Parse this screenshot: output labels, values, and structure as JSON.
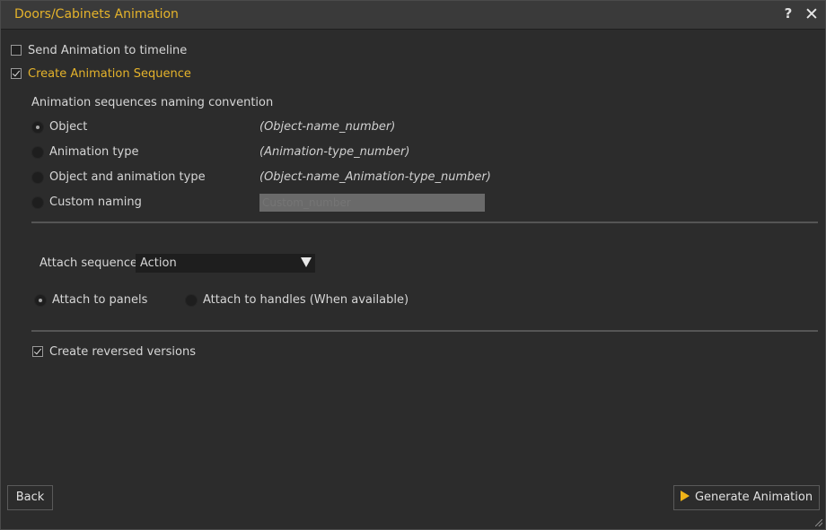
{
  "window": {
    "title": "Doors/Cabinets Animation",
    "help_label": "?",
    "close_label": "✕"
  },
  "options": {
    "send_to_timeline": {
      "label": "Send Animation to timeline",
      "checked": false
    },
    "create_sequence": {
      "label": "Create Animation Sequence",
      "checked": true
    }
  },
  "naming": {
    "heading": "Animation sequences naming convention",
    "choices": [
      {
        "label": "Object",
        "pattern": "(Object-name_number)",
        "selected": true
      },
      {
        "label": "Animation type",
        "pattern": "(Animation-type_number)",
        "selected": false
      },
      {
        "label": "Object and animation type",
        "pattern": "(Object-name_Animation-type_number)",
        "selected": false
      },
      {
        "label": "Custom naming",
        "placeholder": "Custom_number",
        "selected": false
      }
    ]
  },
  "attach": {
    "label": "Attach sequence",
    "selected_value": "Action",
    "panels_label": "Attach to panels",
    "handles_label": "Attach to handles (When available)",
    "panels_selected": true
  },
  "reversed": {
    "label": "Create reversed versions",
    "checked": true
  },
  "footer": {
    "back_label": "Back",
    "generate_label": "Generate Animation"
  },
  "colors": {
    "accent": "#e5b32b",
    "play": "#f0b418",
    "background": "#2c2c2c"
  },
  "icons": {
    "help": "question-mark-icon",
    "close": "close-icon",
    "play": "play-icon",
    "dropdown": "triangle-down-icon"
  }
}
